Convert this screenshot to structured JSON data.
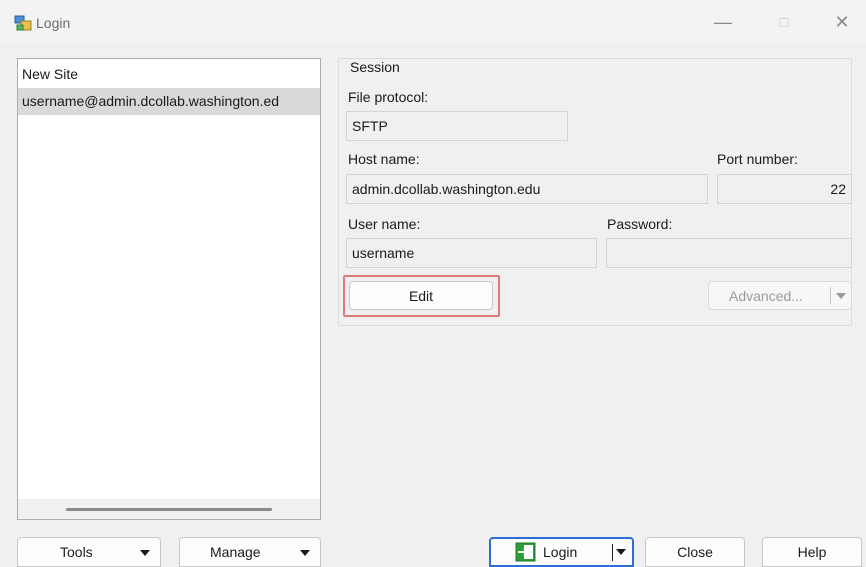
{
  "window": {
    "title": "Login",
    "minimize_icon": "minimize-icon",
    "maximize_icon": "maximize-icon",
    "close_icon": "close-icon",
    "minimize_glyph": "—",
    "maximize_glyph": "□",
    "close_glyph": "✕"
  },
  "sites": [
    {
      "label": "New Site"
    },
    {
      "label": "username@admin.dcollab.washington.ed"
    }
  ],
  "session": {
    "legend": "Session",
    "file_protocol_label": "File protocol:",
    "file_protocol_value": "SFTP",
    "host_name_label": "Host name:",
    "host_name_value": "admin.dcollab.washington.edu",
    "port_label": "Port number:",
    "port_value": "22",
    "user_name_label": "User name:",
    "user_name_value": "username",
    "password_label": "Password:",
    "password_value": "",
    "edit_label": "Edit",
    "advanced_label": "Advanced..."
  },
  "footer": {
    "tools_label": "Tools",
    "manage_label": "Manage",
    "login_label": "Login",
    "close_label": "Close",
    "help_label": "Help"
  },
  "colors": {
    "highlight": "#e07b7b",
    "login_icon": "#2e9e3a",
    "login_button_border": "#2a6fd6"
  }
}
